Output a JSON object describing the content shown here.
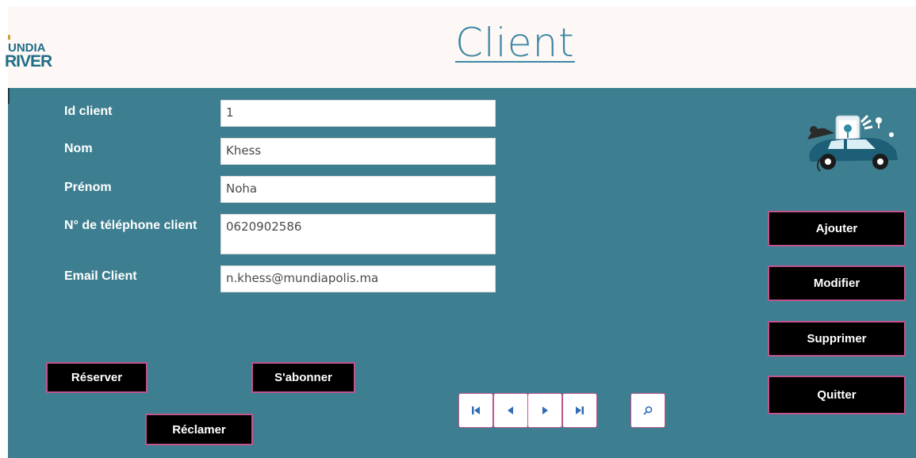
{
  "header": {
    "logo": {
      "line1": "UNDIA",
      "line2": "RIVER"
    },
    "title": "Client"
  },
  "form": {
    "fields": [
      {
        "label": "Id client",
        "value": "1"
      },
      {
        "label": "Nom",
        "value": "Khess"
      },
      {
        "label": "Prénom",
        "value": "Noha"
      },
      {
        "label": "N° de téléphone client",
        "value": "0620902586"
      },
      {
        "label": "Email Client",
        "value": "n.khess@mundiapolis.ma"
      }
    ]
  },
  "actions": {
    "ajouter": "Ajouter",
    "modifier": "Modifier",
    "supprimer": "Supprimer",
    "quitter": "Quitter",
    "reserver": "Réserver",
    "sabonner": "S'abonner",
    "reclamer": "Réclamer"
  },
  "navigation": {
    "icons": [
      "first-record-icon",
      "previous-record-icon",
      "next-record-icon",
      "last-record-icon",
      "search-icon"
    ]
  },
  "colors": {
    "panel": "#3d7f91",
    "header": "#fdf8f5",
    "title": "#3e86a5",
    "button": "#000000",
    "button_border": "#c2548e",
    "nav_icon": "#2f6db5"
  }
}
